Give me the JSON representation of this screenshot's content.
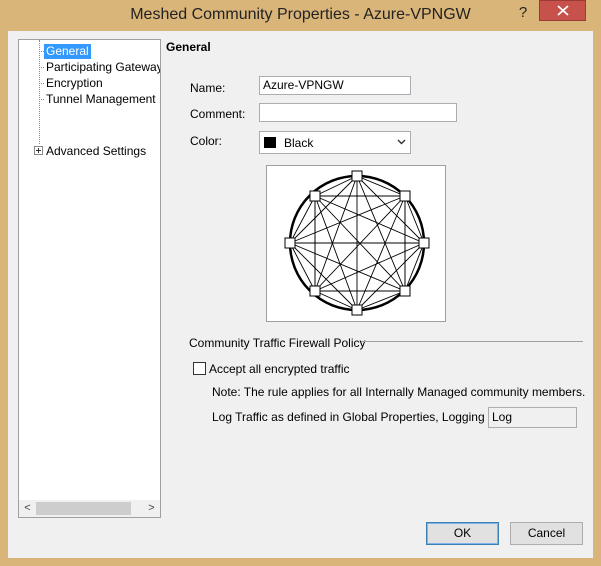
{
  "window": {
    "title": "Meshed Community Properties - Azure-VPNGW",
    "help_label": "?"
  },
  "tree": {
    "items": [
      {
        "label": "General",
        "selected": true
      },
      {
        "label": "Participating Gateways"
      },
      {
        "label": "Encryption"
      },
      {
        "label": "Tunnel Management"
      },
      {
        "label": "Advanced Settings",
        "expandable": true
      }
    ],
    "scroll_left": "<",
    "scroll_right": ">"
  },
  "general": {
    "title": "General",
    "name_label": "Name:",
    "name_value": "Azure-VPNGW",
    "comment_label": "Comment:",
    "comment_value": "",
    "color_label": "Color:",
    "color_value": "Black",
    "color_hex": "#000000"
  },
  "policy": {
    "group_label": "Community Traffic Firewall Policy",
    "accept_label": "Accept all encrypted traffic",
    "accept_checked": false,
    "note": "Note: The rule applies for all Internally Managed community members.",
    "log_label": "Log Traffic as defined in Global Properties, Logging Tab:",
    "log_value": "Log"
  },
  "buttons": {
    "ok": "OK",
    "cancel": "Cancel"
  }
}
